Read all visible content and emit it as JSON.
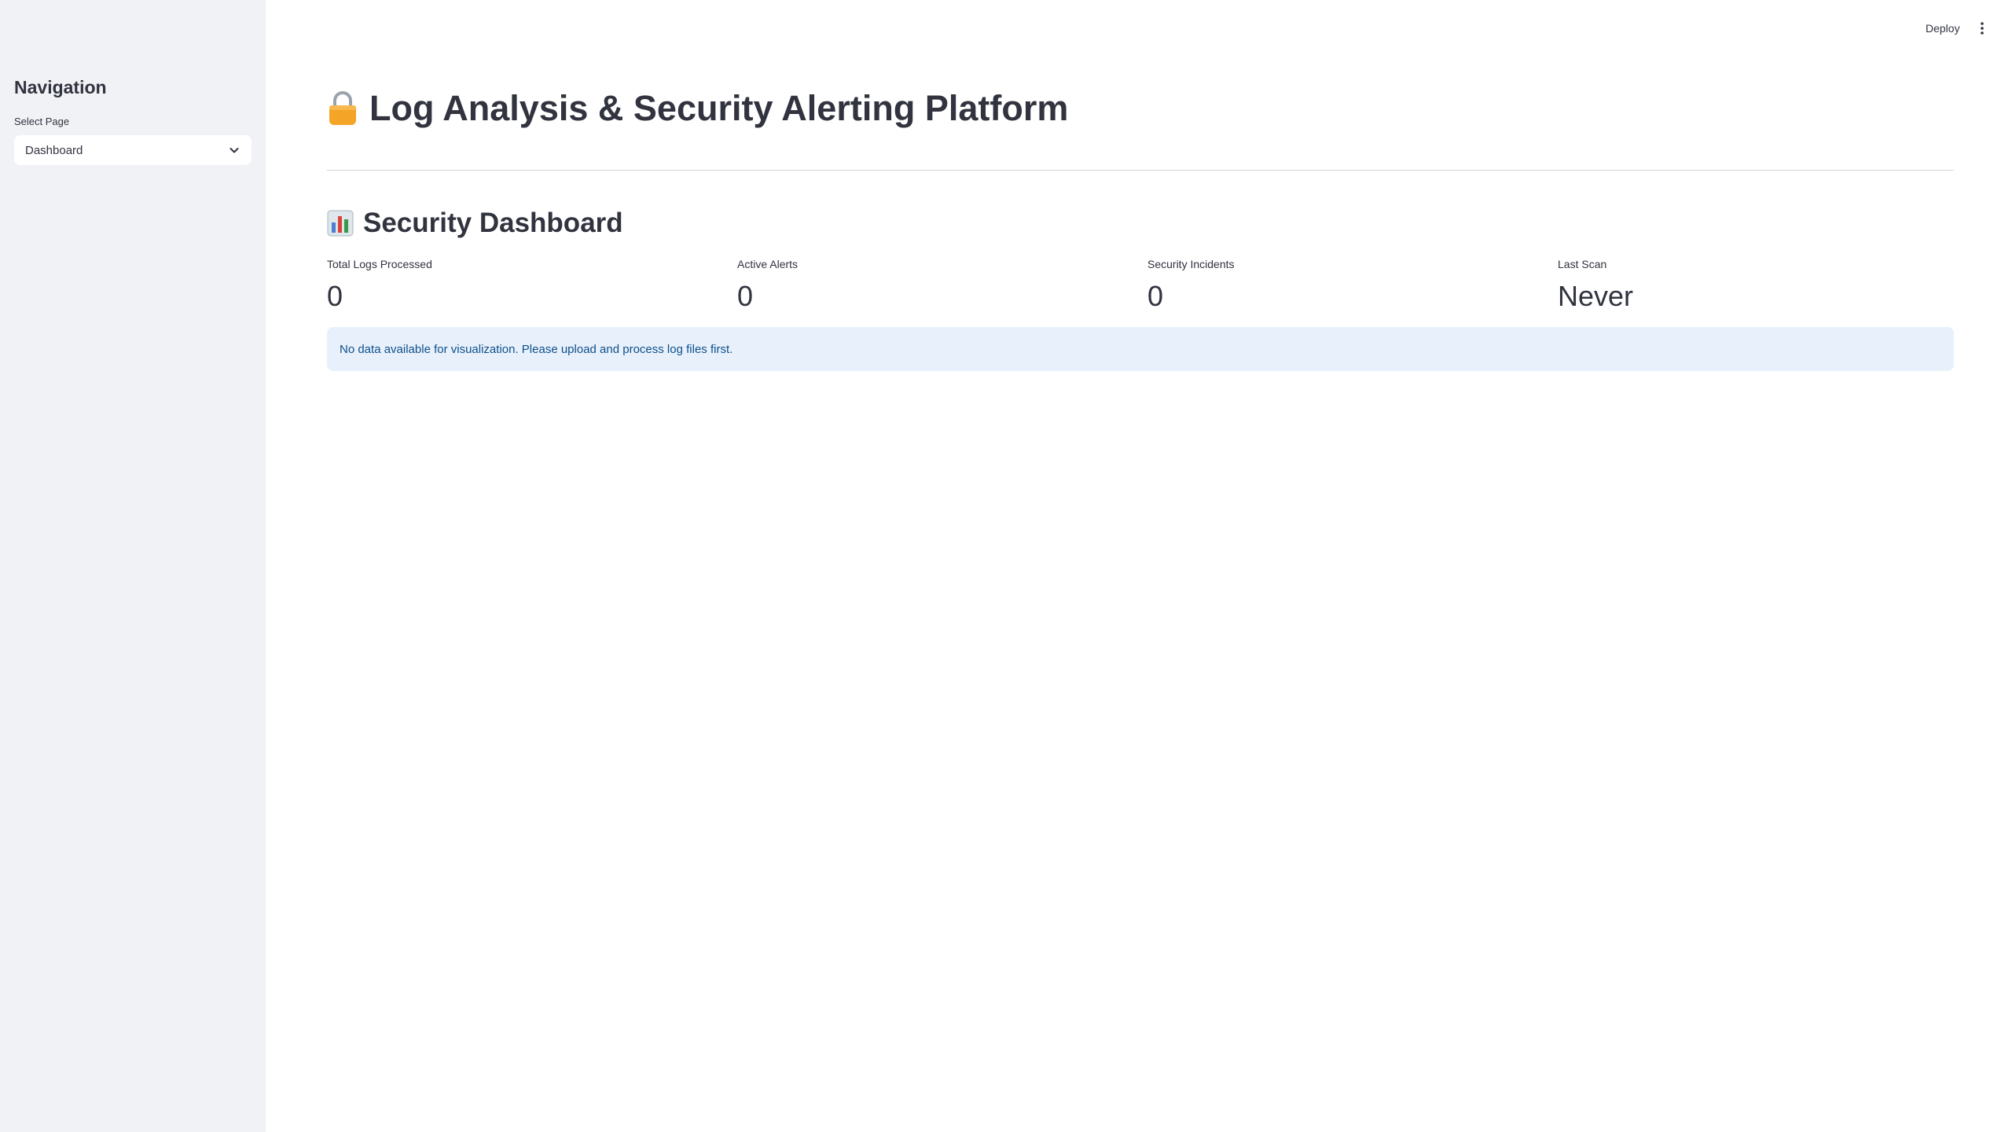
{
  "sidebar": {
    "nav_title": "Navigation",
    "select_label": "Select Page",
    "select_value": "Dashboard"
  },
  "topbar": {
    "deploy_label": "Deploy",
    "menu_icon": "kebab-menu-icon"
  },
  "page": {
    "title": "Log Analysis & Security Alerting Platform",
    "title_icon": "lock-icon"
  },
  "dashboard": {
    "section_title": "Security Dashboard",
    "section_icon": "bar-chart-icon",
    "metrics": [
      {
        "label": "Total Logs Processed",
        "value": "0"
      },
      {
        "label": "Active Alerts",
        "value": "0"
      },
      {
        "label": "Security Incidents",
        "value": "0"
      },
      {
        "label": "Last Scan",
        "value": "Never"
      }
    ],
    "info_message": "No data available for visualization. Please upload and process log files first."
  },
  "colors": {
    "sidebar_bg": "#f0f2f6",
    "text": "#31333f",
    "info_bg": "#e8f1fb",
    "info_text": "#0e4f8b"
  }
}
